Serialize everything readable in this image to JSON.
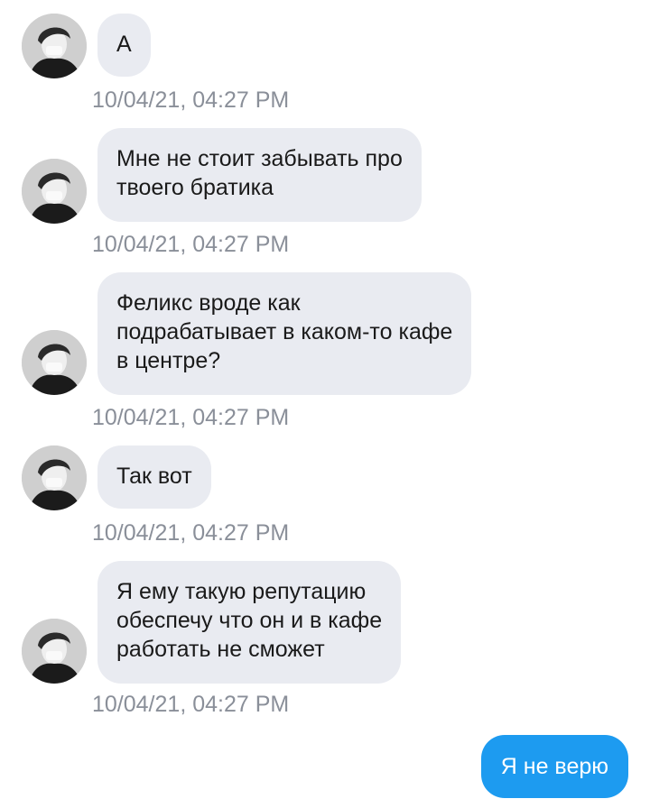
{
  "messages": [
    {
      "text": "А",
      "timestamp": "10/04/21, 04:27 PM"
    },
    {
      "text": "Мне не стоит забывать про\nтвоего братика",
      "timestamp": "10/04/21, 04:27 PM"
    },
    {
      "text": "Феликс вроде как\nподрабатывает в каком-то кафе\nв центре?",
      "timestamp": "10/04/21, 04:27 PM"
    },
    {
      "text": "Так вот",
      "timestamp": "10/04/21, 04:27 PM"
    },
    {
      "text": "Я ему такую репутацию\nобеспечу что он и в кафе\nработать не сможет",
      "timestamp": "10/04/21, 04:27 PM"
    }
  ],
  "outgoing_message": {
    "text": "Я не верю"
  },
  "colors": {
    "incoming_bubble": "#e9ebf1",
    "outgoing_bubble": "#1d9bf0",
    "timestamp": "#8a8f99"
  },
  "icons": {
    "avatar": "avatar-photo"
  }
}
